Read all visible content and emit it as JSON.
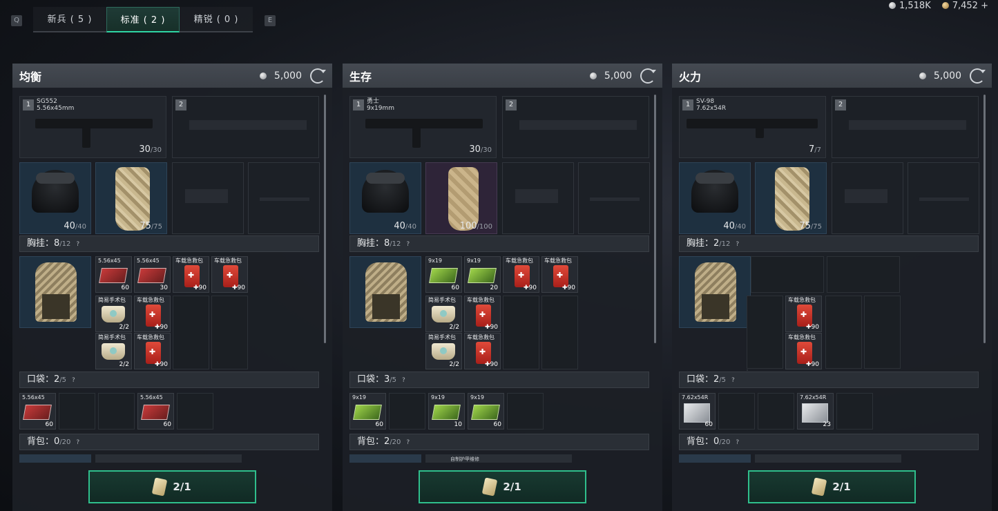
{
  "key_hints": {
    "left": "Q",
    "right": "E"
  },
  "tabs": [
    {
      "label": "新兵 ( 5 )",
      "active": false
    },
    {
      "label": "标准 ( 2 )",
      "active": true
    },
    {
      "label": "精锐 ( 0 )",
      "active": false
    }
  ],
  "currency": {
    "silver": "1,518K",
    "gold": "7,452",
    "gold_add": "+"
  },
  "colors": {
    "accent": "#2fd6a4",
    "panel_header": "#3a3f46"
  },
  "panels": [
    {
      "title": "均衡",
      "price": "5,000",
      "weapon1": {
        "slot": "1",
        "name": "SG552",
        "caliber": "5.56x45mm",
        "ammo": "30",
        "ammo_max": "/30"
      },
      "weapon2_slot": "2",
      "helmet": {
        "dur": "40",
        "max": "/40"
      },
      "armor": {
        "dur": "75",
        "max": "/75"
      },
      "chest": {
        "label": "胸挂：",
        "count": "8",
        "max": "/12",
        "help": "?"
      },
      "chest_items": [
        {
          "top": "5.56x45",
          "cnt": "60",
          "type": "ammo-red"
        },
        {
          "top": "5.56x45",
          "cnt": "30",
          "type": "ammo-red"
        },
        {
          "top": "车载急救包",
          "cnt": "✚90",
          "type": "medkit"
        },
        {
          "top": "车载急救包",
          "cnt": "✚90",
          "type": "medkit"
        },
        {
          "top": "简易手术包",
          "cnt": "2/2",
          "type": "surgkit"
        },
        {
          "top": "车载急救包",
          "cnt": "✚90",
          "type": "medkit"
        },
        {
          "top": "简易手术包",
          "cnt": "2/2",
          "type": "surgkit"
        },
        {
          "top": "车载急救包",
          "cnt": "✚90",
          "type": "medkit"
        }
      ],
      "pocket": {
        "label": "口袋：",
        "count": "2",
        "max": "/5",
        "help": "?"
      },
      "pocket_items": [
        {
          "top": "5.56x45",
          "cnt": "60",
          "type": "ammo-red"
        },
        {
          "top": "",
          "cnt": "",
          "type": "empty"
        },
        {
          "top": "",
          "cnt": "",
          "type": "empty"
        },
        {
          "top": "5.56x45",
          "cnt": "60",
          "type": "ammo-red"
        },
        {
          "top": "",
          "cnt": "",
          "type": "empty"
        }
      ],
      "backpack": {
        "label": "背包：",
        "count": "0",
        "max": "/20",
        "help": "?"
      },
      "backpack_item": "",
      "footer": "2/1"
    },
    {
      "title": "生存",
      "price": "5,000",
      "weapon1": {
        "slot": "1",
        "name": "勇士",
        "caliber": "9x19mm",
        "ammo": "30",
        "ammo_max": "/30"
      },
      "weapon2_slot": "2",
      "helmet": {
        "dur": "40",
        "max": "/40"
      },
      "armor": {
        "dur": "100",
        "max": "/100"
      },
      "chest": {
        "label": "胸挂：",
        "count": "8",
        "max": "/12",
        "help": "?"
      },
      "chest_items": [
        {
          "top": "9x19",
          "cnt": "60",
          "type": "ammo-green"
        },
        {
          "top": "9x19",
          "cnt": "20",
          "type": "ammo-green"
        },
        {
          "top": "车载急救包",
          "cnt": "✚90",
          "type": "medkit"
        },
        {
          "top": "车载急救包",
          "cnt": "✚90",
          "type": "medkit"
        },
        {
          "top": "简易手术包",
          "cnt": "2/2",
          "type": "surgkit"
        },
        {
          "top": "车载急救包",
          "cnt": "✚90",
          "type": "medkit"
        },
        {
          "top": "简易手术包",
          "cnt": "2/2",
          "type": "surgkit"
        },
        {
          "top": "车载急救包",
          "cnt": "✚90",
          "type": "medkit"
        }
      ],
      "pocket": {
        "label": "口袋：",
        "count": "3",
        "max": "/5",
        "help": "?"
      },
      "pocket_items": [
        {
          "top": "9x19",
          "cnt": "60",
          "type": "ammo-green"
        },
        {
          "top": "",
          "cnt": "",
          "type": "empty"
        },
        {
          "top": "9x19",
          "cnt": "10",
          "type": "ammo-green"
        },
        {
          "top": "9x19",
          "cnt": "60",
          "type": "ammo-green"
        },
        {
          "top": "",
          "cnt": "",
          "type": "empty"
        }
      ],
      "backpack": {
        "label": "背包：",
        "count": "2",
        "max": "/20",
        "help": "?"
      },
      "backpack_item": "自制护甲维修",
      "footer": "2/1"
    },
    {
      "title": "火力",
      "price": "5,000",
      "weapon1": {
        "slot": "1",
        "name": "SV-98",
        "caliber": "7.62x54R",
        "ammo": "7",
        "ammo_max": "/7"
      },
      "weapon2_slot": "2",
      "helmet": {
        "dur": "40",
        "max": "/40"
      },
      "armor": {
        "dur": "75",
        "max": "/75"
      },
      "chest": {
        "label": "胸挂：",
        "count": "2",
        "max": "/12",
        "help": "?"
      },
      "chest_items": [
        {
          "top": "",
          "cnt": "",
          "type": "empty"
        },
        {
          "top": "",
          "cnt": "",
          "type": "empty"
        },
        {
          "top": "",
          "cnt": "",
          "type": "empty"
        },
        {
          "top": "",
          "cnt": "",
          "type": "empty"
        },
        {
          "top": "",
          "cnt": "",
          "type": "empty"
        },
        {
          "top": "车载急救包",
          "cnt": "✚90",
          "type": "medkit"
        },
        {
          "top": "",
          "cnt": "",
          "type": "empty"
        },
        {
          "top": "车载急救包",
          "cnt": "✚90",
          "type": "medkit"
        }
      ],
      "pocket": {
        "label": "口袋：",
        "count": "2",
        "max": "/5",
        "help": "?"
      },
      "pocket_items": [
        {
          "top": "7.62x54R",
          "cnt": "60",
          "type": "ammo-white"
        },
        {
          "top": "",
          "cnt": "",
          "type": "empty"
        },
        {
          "top": "",
          "cnt": "",
          "type": "empty"
        },
        {
          "top": "7.62x54R",
          "cnt": "23",
          "type": "ammo-white"
        },
        {
          "top": "",
          "cnt": "",
          "type": "empty"
        }
      ],
      "backpack": {
        "label": "背包：",
        "count": "0",
        "max": "/20",
        "help": "?"
      },
      "backpack_item": "",
      "footer": "2/1"
    }
  ]
}
